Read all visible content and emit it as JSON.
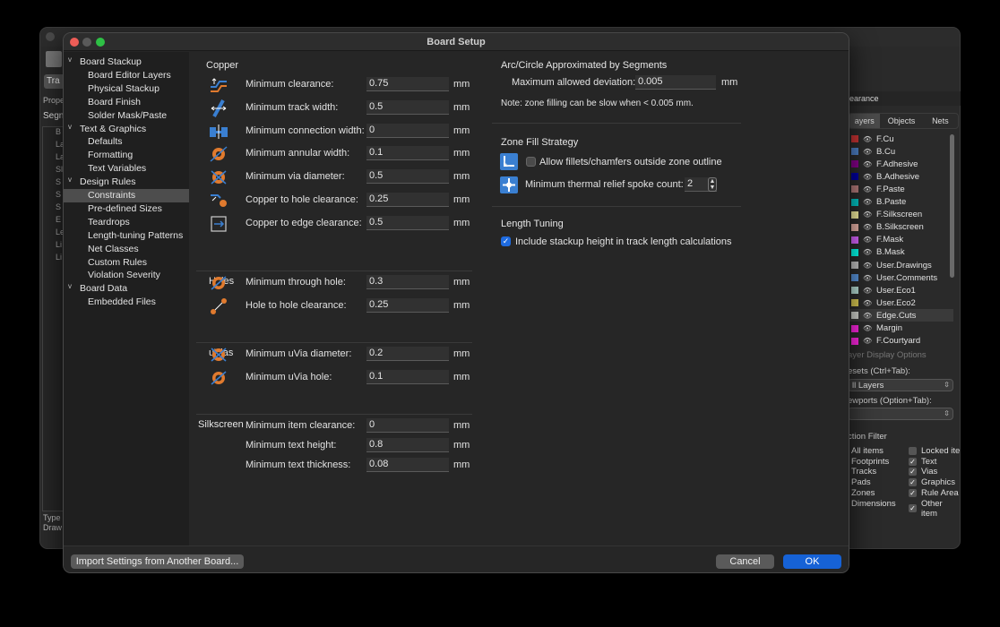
{
  "dialog": {
    "title": "Board Setup"
  },
  "tree": [
    {
      "label": "Board Stackup",
      "level": 0,
      "arrow": "v"
    },
    {
      "label": "Board Editor Layers",
      "level": 1
    },
    {
      "label": "Physical Stackup",
      "level": 1
    },
    {
      "label": "Board Finish",
      "level": 1
    },
    {
      "label": "Solder Mask/Paste",
      "level": 1
    },
    {
      "label": "Text & Graphics",
      "level": 0,
      "arrow": "v"
    },
    {
      "label": "Defaults",
      "level": 1
    },
    {
      "label": "Formatting",
      "level": 1
    },
    {
      "label": "Text Variables",
      "level": 1
    },
    {
      "label": "Design Rules",
      "level": 0,
      "arrow": "v"
    },
    {
      "label": "Constraints",
      "level": 1,
      "selected": true
    },
    {
      "label": "Pre-defined Sizes",
      "level": 1
    },
    {
      "label": "Teardrops",
      "level": 1
    },
    {
      "label": "Length-tuning Patterns",
      "level": 1
    },
    {
      "label": "Net Classes",
      "level": 1
    },
    {
      "label": "Custom Rules",
      "level": 1
    },
    {
      "label": "Violation Severity",
      "level": 1
    },
    {
      "label": "Board Data",
      "level": 0,
      "arrow": "v"
    },
    {
      "label": "Embedded Files",
      "level": 1
    }
  ],
  "copper": {
    "title": "Copper",
    "rows": [
      {
        "label": "Minimum clearance:",
        "value": "0.75",
        "unit": "mm",
        "icon": "clearance-icon"
      },
      {
        "label": "Minimum track width:",
        "value": "0.5",
        "unit": "mm",
        "icon": "track-width-icon"
      },
      {
        "label": "Minimum connection width:",
        "value": "0",
        "unit": "mm",
        "icon": "connection-width-icon"
      },
      {
        "label": "Minimum annular width:",
        "value": "0.1",
        "unit": "mm",
        "icon": "annular-width-icon"
      },
      {
        "label": "Minimum via diameter:",
        "value": "0.5",
        "unit": "mm",
        "icon": "via-diameter-icon"
      },
      {
        "label": "Copper to hole clearance:",
        "value": "0.25",
        "unit": "mm",
        "icon": "hole-clearance-icon"
      },
      {
        "label": "Copper to edge clearance:",
        "value": "0.5",
        "unit": "mm",
        "icon": "edge-clearance-icon"
      }
    ]
  },
  "holes": {
    "title": "Holes",
    "rows": [
      {
        "label": "Minimum through hole:",
        "value": "0.3",
        "unit": "mm",
        "icon": "through-hole-icon"
      },
      {
        "label": "Hole to hole clearance:",
        "value": "0.25",
        "unit": "mm",
        "icon": "hole-to-hole-icon"
      }
    ]
  },
  "uvias": {
    "title": "uVias",
    "rows": [
      {
        "label": "Minimum uVia diameter:",
        "value": "0.2",
        "unit": "mm",
        "icon": "uvia-diameter-icon"
      },
      {
        "label": "Minimum uVia hole:",
        "value": "0.1",
        "unit": "mm",
        "icon": "uvia-hole-icon"
      }
    ]
  },
  "silkscreen": {
    "title": "Silkscreen",
    "rows": [
      {
        "label": "Minimum item clearance:",
        "value": "0",
        "unit": "mm"
      },
      {
        "label": "Minimum text height:",
        "value": "0.8",
        "unit": "mm"
      },
      {
        "label": "Minimum text thickness:",
        "value": "0.08",
        "unit": "mm"
      }
    ]
  },
  "arc": {
    "title": "Arc/Circle Approximated by Segments",
    "label": "Maximum allowed deviation:",
    "value": "0.005",
    "unit": "mm",
    "note": "Note: zone filling can be slow when < 0.005 mm."
  },
  "zone": {
    "title": "Zone Fill Strategy",
    "fillets_label": "Allow fillets/chamfers outside zone outline",
    "fillets_checked": false,
    "spoke_label": "Minimum thermal relief spoke count:",
    "spoke_value": "2"
  },
  "length": {
    "title": "Length Tuning",
    "stackup_label": "Include stackup height in track length calculations",
    "stackup_checked": true
  },
  "footer": {
    "import_label": "Import Settings from Another Board...",
    "cancel_label": "Cancel",
    "ok_label": "OK"
  },
  "background": {
    "toolbar_tab": "Tra",
    "left_labels": [
      "Prope",
      "Segn"
    ],
    "left_items": [
      "B",
      "La",
      "La",
      "Sl",
      "S",
      "S",
      "S",
      "E",
      "Le",
      "Li",
      "Li"
    ],
    "bottom_labels": [
      "Type",
      "Draw"
    ],
    "right_panel": {
      "clearance_label": "learance",
      "tabs": [
        "ayers",
        "Objects",
        "Nets"
      ],
      "layers": [
        {
          "name": "F.Cu",
          "color": "#c83434"
        },
        {
          "name": "B.Cu",
          "color": "#4d7fc4"
        },
        {
          "name": "F.Adhesive",
          "color": "#84008a"
        },
        {
          "name": "B.Adhesive",
          "color": "#0000a0"
        },
        {
          "name": "F.Paste",
          "color": "#b47c7c"
        },
        {
          "name": "B.Paste",
          "color": "#00c2c2"
        },
        {
          "name": "F.Silkscreen",
          "color": "#f2ed9f"
        },
        {
          "name": "B.Silkscreen",
          "color": "#e8b2a7"
        },
        {
          "name": "F.Mask",
          "color": "#d864ff"
        },
        {
          "name": "B.Mask",
          "color": "#02ffee"
        },
        {
          "name": "User.Drawings",
          "color": "#c2c2c2"
        },
        {
          "name": "User.Comments",
          "color": "#5994dc"
        },
        {
          "name": "User.Eco1",
          "color": "#b4dbd2"
        },
        {
          "name": "User.Eco2",
          "color": "#d8c852"
        },
        {
          "name": "Edge.Cuts",
          "color": "#d0d2cd"
        },
        {
          "name": "Margin",
          "color": "#ff26e2"
        },
        {
          "name": "F.Courtyard",
          "color": "#ff26e2"
        }
      ],
      "layer_display_options": "ayer Display Options",
      "presets_label": "esets (Ctrl+Tab):",
      "presets_value": "ll Layers",
      "viewports_label": "ewports (Option+Tab):",
      "selection_filter": "ction Filter",
      "filters_left": [
        {
          "label": "All items"
        },
        {
          "label": "Footprints"
        },
        {
          "label": "Tracks"
        },
        {
          "label": "Pads"
        },
        {
          "label": "Zones"
        },
        {
          "label": "Dimensions"
        }
      ],
      "filters_right": [
        {
          "label": "Locked ite",
          "checked": false
        },
        {
          "label": "Text",
          "checked": true
        },
        {
          "label": "Vias",
          "checked": true
        },
        {
          "label": "Graphics",
          "checked": true
        },
        {
          "label": "Rule Area",
          "checked": true
        },
        {
          "label": "Other item",
          "checked": true
        }
      ]
    }
  },
  "colors": {
    "accent": "#1662d6",
    "icon_orange": "#e07a2e",
    "icon_blue": "#3a7fd1"
  }
}
